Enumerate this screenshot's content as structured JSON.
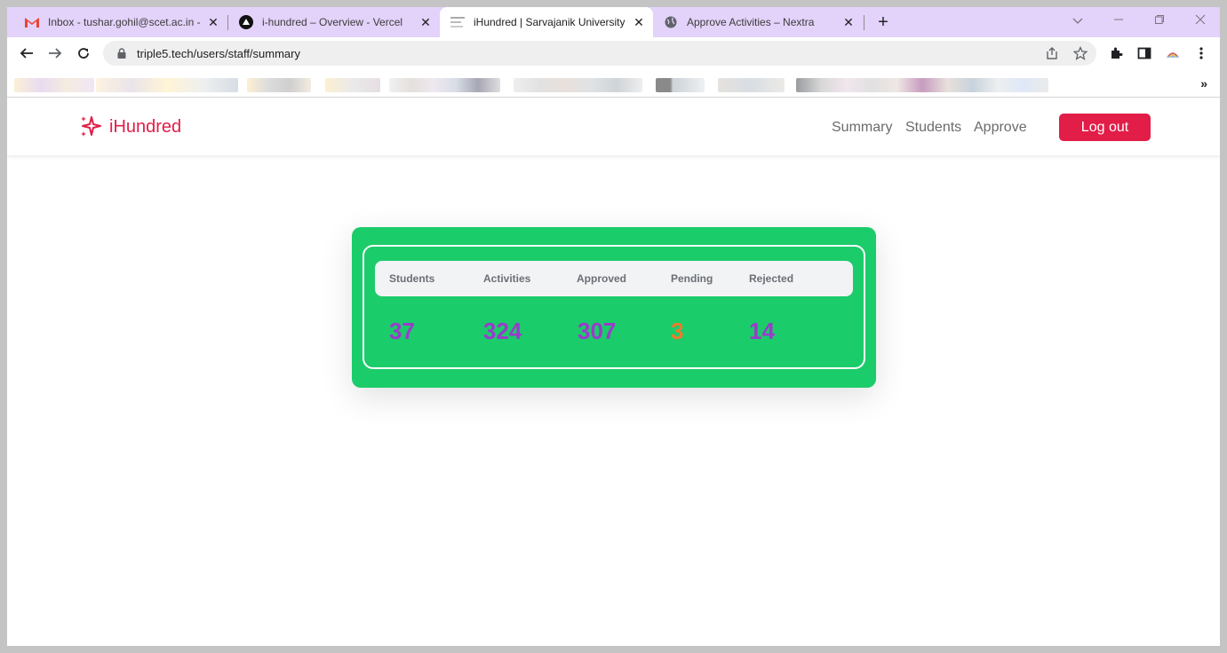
{
  "browser": {
    "tabs": [
      {
        "title": "Inbox - tushar.gohil@scet.ac.in -",
        "icon": "gmail-icon"
      },
      {
        "title": "i-hundred – Overview - Vercel",
        "icon": "vercel-icon"
      },
      {
        "title": "iHundred | Sarvajanik University",
        "icon": "page-icon",
        "active": true
      },
      {
        "title": "Approve Activities – Nextra",
        "icon": "globe-icon"
      }
    ],
    "url": "triple5.tech/users/staff/summary"
  },
  "app": {
    "brand": "iHundred",
    "brand_color": "#e11d48",
    "nav": {
      "summary": "Summary",
      "students": "Students",
      "approve": "Approve",
      "logout": "Log out"
    },
    "card_color": "#1bcc6a",
    "stats": {
      "headers": {
        "students": "Students",
        "activities": "Activities",
        "approved": "Approved",
        "pending": "Pending",
        "rejected": "Rejected"
      },
      "values": {
        "students": "37",
        "activities": "324",
        "approved": "307",
        "pending": "3",
        "rejected": "14"
      }
    }
  }
}
